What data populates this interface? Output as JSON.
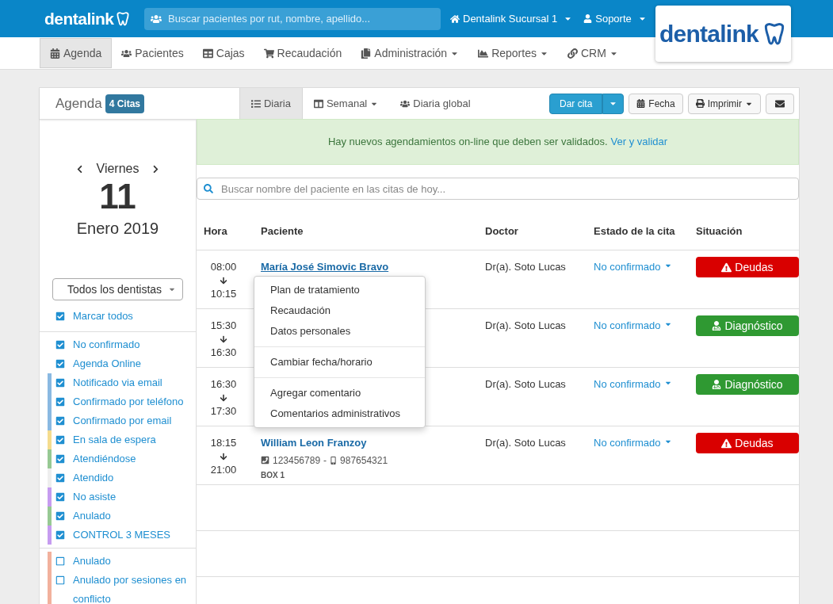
{
  "top_bar": {
    "brand": "dentalink",
    "search_placeholder": "Buscar pacientes por rut, nombre, apellido...",
    "branch": "Dentalink Sucursal 1",
    "user": "Soporte",
    "logo_text": "dentalink"
  },
  "nav": [
    {
      "label": "Agenda",
      "selected": true,
      "has_caret": false
    },
    {
      "label": "Pacientes",
      "selected": false,
      "has_caret": false
    },
    {
      "label": "Cajas",
      "selected": false,
      "has_caret": false
    },
    {
      "label": "Recaudación",
      "selected": false,
      "has_caret": false
    },
    {
      "label": "Administración",
      "selected": false,
      "has_caret": true
    },
    {
      "label": "Reportes",
      "selected": false,
      "has_caret": true
    },
    {
      "label": "CRM",
      "selected": false,
      "has_caret": true
    }
  ],
  "agenda_header": {
    "title": "Agenda",
    "count": "4 Citas",
    "views": [
      {
        "label": "Diaria",
        "selected": true,
        "has_caret": false
      },
      {
        "label": "Semanal",
        "selected": false,
        "has_caret": true
      },
      {
        "label": "Diaria global",
        "selected": false,
        "has_caret": false
      }
    ],
    "actions": {
      "new": "Dar cita",
      "date": "Fecha",
      "print": "Imprimir"
    }
  },
  "alert": {
    "text": "Hay nuevos agendamientos on-line que deben ser validados.",
    "link": "Ver y validar"
  },
  "date": {
    "weekday": "Viernes",
    "day": "11",
    "month_year": "Enero 2019"
  },
  "dentist_select": "Todos los dentistas",
  "mark_all": {
    "label": "Marcar todos",
    "checked": true
  },
  "filter_groups": [
    [
      {
        "label": "No confirmado",
        "checked": true
      },
      {
        "label": "Agenda Online",
        "checked": true
      },
      {
        "label": "Notificado via email",
        "checked": true,
        "color": "#8ab9e2"
      },
      {
        "label": "Confirmado por teléfono",
        "checked": true,
        "color": "#8ab9e2"
      },
      {
        "label": "Confirmado por email",
        "checked": true,
        "color": "#8ab9e2"
      },
      {
        "label": "En sala de espera",
        "checked": true,
        "color": "#f5dc8e"
      },
      {
        "label": "Atendiéndose",
        "checked": true,
        "color": "#97c993"
      },
      {
        "label": "Atendido",
        "checked": true,
        "color": "#eeeeee"
      },
      {
        "label": "No asiste",
        "checked": true,
        "color": "#c69cf0"
      },
      {
        "label": "Anulado",
        "checked": true,
        "color": "#97c993"
      },
      {
        "label": "CONTROL 3 MESES",
        "checked": true,
        "color": "#c69cf0"
      }
    ],
    [
      {
        "label": "Anulado",
        "checked": false,
        "color": "#f2b19d"
      },
      {
        "label": "Anulado por sesiones en conflicto",
        "checked": false,
        "color": "#f2b19d"
      }
    ]
  ],
  "search_placeholder": "Buscar nombre del paciente en las citas de hoy...",
  "columns": [
    "Hora",
    "Paciente",
    "Doctor",
    "Estado de la cita",
    "Situación"
  ],
  "rows": [
    {
      "start": "08:00",
      "end": "10:15",
      "patient": "María José Simovic Bravo",
      "doctor": "Dr(a). Soto Lucas",
      "status": "No confirmado",
      "situation": {
        "label": "Deudas",
        "kind": "debt"
      }
    },
    {
      "start": "15:30",
      "end": "16:30",
      "doctor": "Dr(a). Soto Lucas",
      "status": "No confirmado",
      "situation": {
        "label": "Diagnóstico",
        "kind": "diagnosis"
      }
    },
    {
      "start": "16:30",
      "end": "17:30",
      "doctor": "Dr(a). Soto Lucas",
      "status": "No confirmado",
      "situation": {
        "label": "Diagnóstico",
        "kind": "diagnosis"
      }
    },
    {
      "start": "18:15",
      "end": "21:00",
      "patient": "William Leon Franzoy",
      "phone": "123456789",
      "separator": "-",
      "mobile": "987654321",
      "box": "BOX 1",
      "doctor": "Dr(a). Soto Lucas",
      "status": "No confirmado",
      "situation": {
        "label": "Deudas",
        "kind": "debt"
      }
    }
  ],
  "context_menu": [
    [
      "Plan de tratamiento",
      "Recaudación",
      "Datos personales"
    ],
    [
      "Cambiar fecha/horario"
    ],
    [
      "Agregar comentario",
      "Comentarios administrativos"
    ]
  ]
}
